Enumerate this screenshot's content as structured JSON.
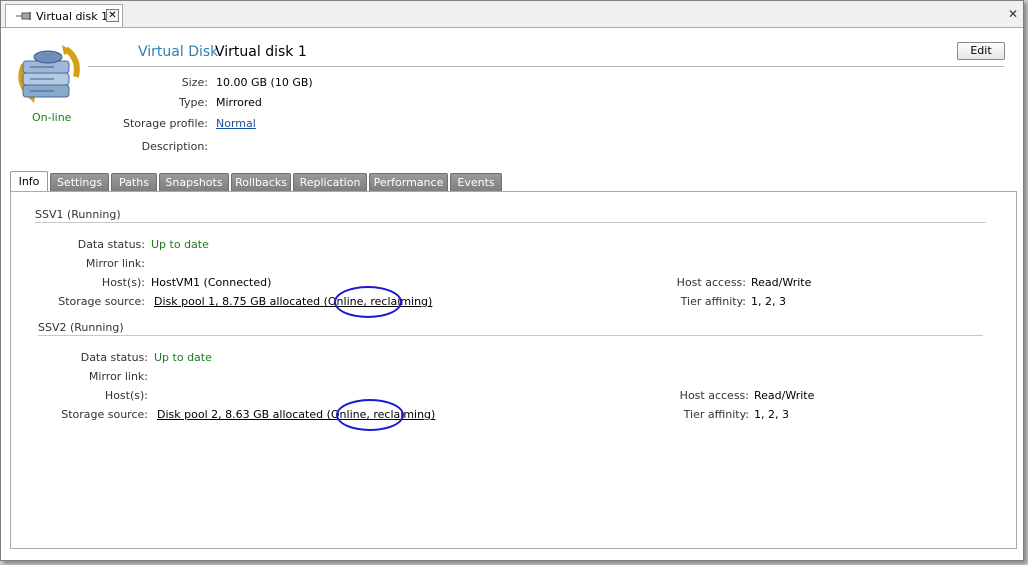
{
  "doc_tab": {
    "title": "Virtual disk 1",
    "close": "✕"
  },
  "window": {
    "close": "✕"
  },
  "header": {
    "kind": "Virtual Disk",
    "name": "Virtual disk 1",
    "status": "On-line",
    "edit_label": "Edit"
  },
  "props": {
    "size_label": "Size:",
    "size_value": "10.00 GB (10 GB)",
    "type_label": "Type:",
    "type_value": "Mirrored",
    "profile_label": "Storage profile:",
    "profile_value": "Normal",
    "desc_label": "Description:",
    "desc_value": ""
  },
  "tabs": [
    "Info",
    "Settings",
    "Paths",
    "Snapshots",
    "Rollbacks",
    "Replication",
    "Performance",
    "Events"
  ],
  "servers": [
    {
      "title": "SSV1 (Running)",
      "data_status_label": "Data status:",
      "data_status": "Up to date",
      "mirror_label": "Mirror link:",
      "mirror": "",
      "hosts_label": "Host(s):",
      "hosts": "HostVM1 (Connected)",
      "source_label": "Storage source:",
      "source_main": "Disk pool 1, 8.75 GB allocated (Online",
      "source_tail": ", reclaiming)",
      "access_label": "Host access:",
      "access": "Read/Write",
      "tier_label": "Tier affinity:",
      "tier": "1, 2, 3"
    },
    {
      "title": "SSV2 (Running)",
      "data_status_label": "Data status:",
      "data_status": "Up to date",
      "mirror_label": "Mirror link:",
      "mirror": "",
      "hosts_label": "Host(s):",
      "hosts": "",
      "source_label": "Storage source:",
      "source_main": "Disk pool 2, 8.63 GB allocated (Online",
      "source_tail": ", reclaiming)",
      "access_label": "Host access:",
      "access": "Read/Write",
      "tier_label": "Tier affinity:",
      "tier": "1, 2, 3"
    }
  ],
  "icons": {
    "pin": "pin-icon",
    "disk": "virtual-disk-icon",
    "annotation": "annotation-circle"
  },
  "colors": {
    "status_green": "#1f7a1f",
    "kind_blue": "#2f7fb0",
    "link_blue": "#1a4fa0",
    "annotation_blue": "#1a1ad0"
  }
}
